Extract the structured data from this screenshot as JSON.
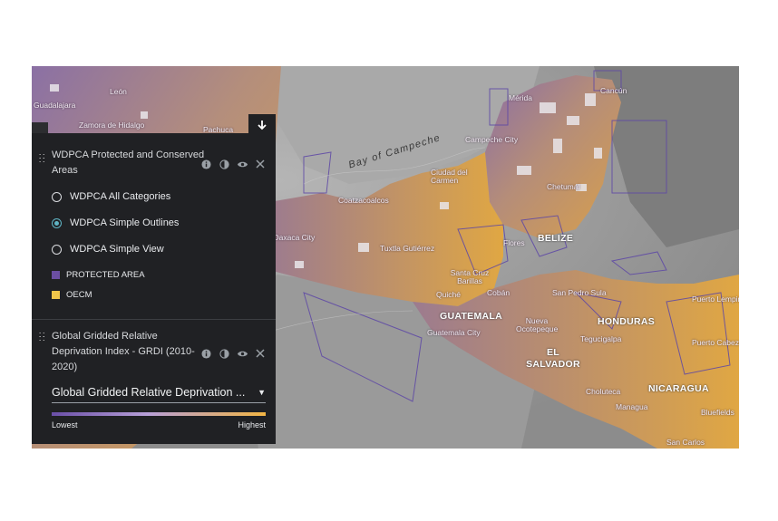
{
  "map": {
    "sea_label": "Bay of Campeche",
    "places": [
      {
        "name": "León"
      },
      {
        "name": "Guadalajara"
      },
      {
        "name": "Zamora de Hidalgo"
      },
      {
        "name": "Pachuca"
      },
      {
        "name": "Mérida"
      },
      {
        "name": "Cancún"
      },
      {
        "name": "Campeche City"
      },
      {
        "name": "Ciudad del Carmen"
      },
      {
        "name": "Chetumal"
      },
      {
        "name": "Coatzacoalcos"
      },
      {
        "name": "Oaxaca City"
      },
      {
        "name": "Tuxtla Gutiérrez"
      },
      {
        "name": "Flores"
      },
      {
        "name": "Santa Cruz Barillas"
      },
      {
        "name": "Cobán"
      },
      {
        "name": "Quiché"
      },
      {
        "name": "San Pedro Sula"
      },
      {
        "name": "Guatemala City"
      },
      {
        "name": "Nueva Ocotepeque"
      },
      {
        "name": "Tegucigalpa"
      },
      {
        "name": "Choluteca"
      },
      {
        "name": "Managua"
      },
      {
        "name": "Bluefields"
      },
      {
        "name": "Puerto Lempira"
      },
      {
        "name": "Puerto Cabezas"
      },
      {
        "name": "San Carlos"
      }
    ],
    "countries": [
      {
        "name": "BELIZE"
      },
      {
        "name": "GUATEMALA"
      },
      {
        "name": "HONDURAS"
      },
      {
        "name": "EL SALVADOR"
      },
      {
        "name": "NICARAGUA"
      }
    ]
  },
  "panel": {
    "collapse_icon": "arrow-down-icon",
    "layers": [
      {
        "title": "WDPCA Protected and Conserved Areas",
        "options": [
          {
            "label": "WDPCA All Categories",
            "selected": false
          },
          {
            "label": "WDPCA Simple Outlines",
            "selected": true
          },
          {
            "label": "WDPCA Simple View",
            "selected": false
          }
        ],
        "legend": [
          {
            "label": "PROTECTED AREA",
            "color": "#6b4fa3"
          },
          {
            "label": "OECM",
            "color": "#f0c64a"
          }
        ]
      },
      {
        "title": "Global Gridded Relative Deprivation Index - GRDI (2010-2020)",
        "selected_value": "Global Gridded Relative Deprivation ...",
        "gradient_low": "Lowest",
        "gradient_high": "Highest"
      }
    ],
    "tool_icons": [
      "info-icon",
      "opacity-icon",
      "visibility-icon",
      "close-icon"
    ]
  },
  "colors": {
    "panel_bg": "#202124",
    "accent": "#5fb4c4",
    "land_low": "#6a4fa8",
    "land_high": "#f2b544"
  }
}
